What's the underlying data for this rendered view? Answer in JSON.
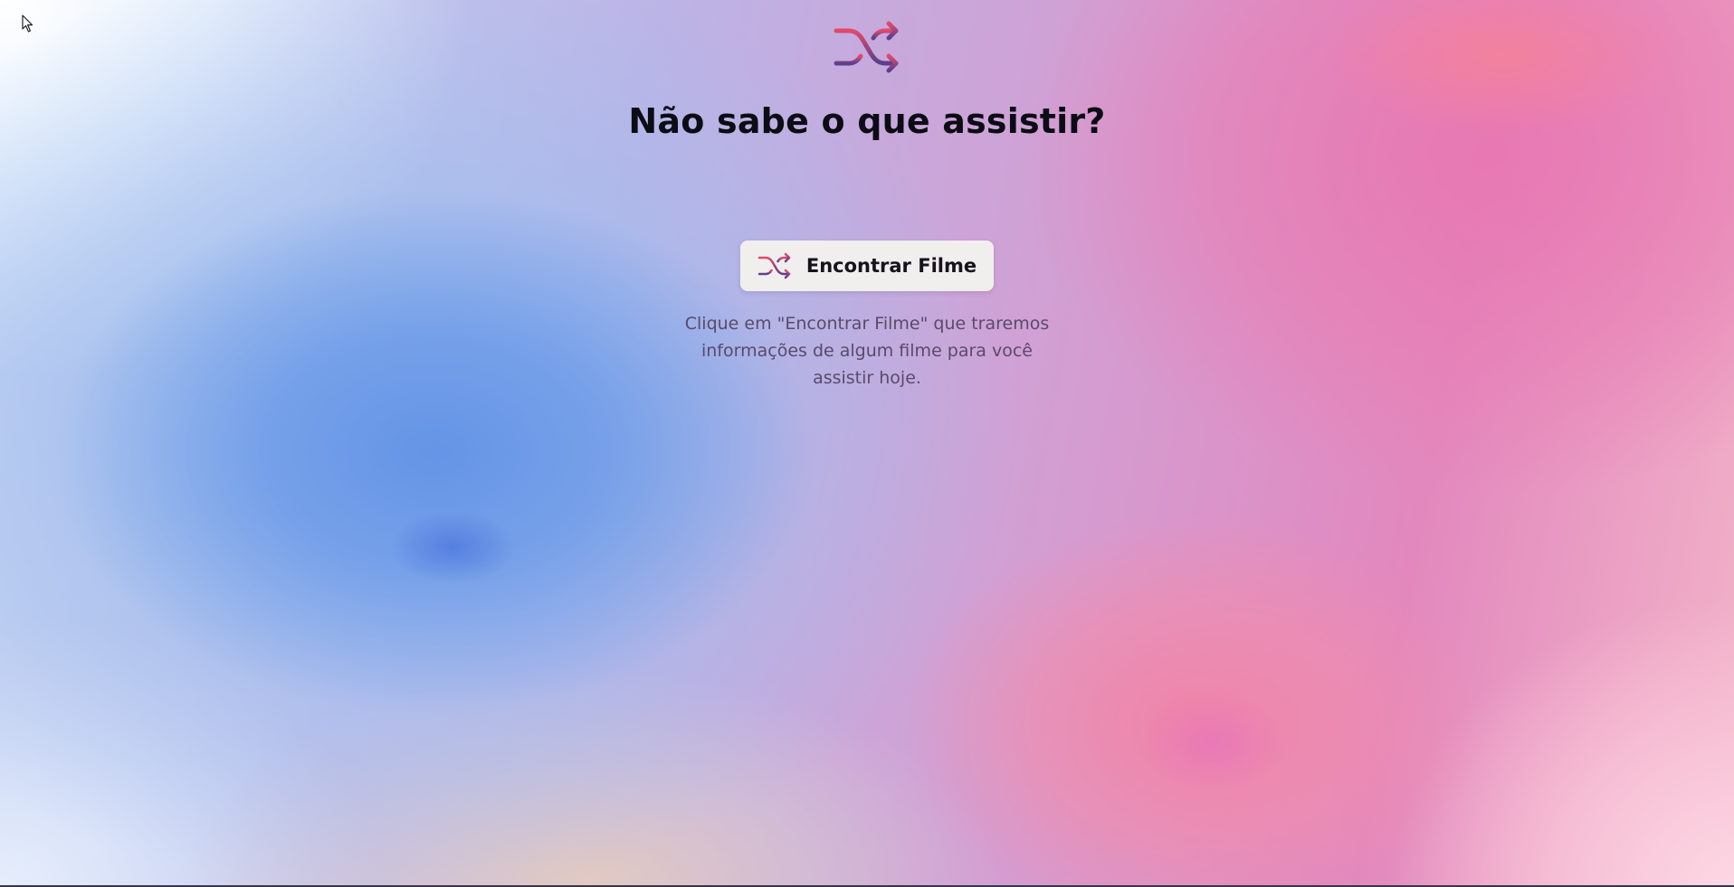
{
  "hero": {
    "title": "Não sabe o que assistir?",
    "logo_icon": "shuffle-icon"
  },
  "action": {
    "button_label": "Encontrar Filme",
    "button_icon": "shuffle-icon"
  },
  "description": "Clique em \"Encontrar Filme\" que traremos informações de algum filme para você assistir hoje.",
  "colors": {
    "icon_gradient_start": "#e24a6c",
    "icon_gradient_end": "#5b3f8e",
    "title_color": "#0c0c14",
    "button_background": "#f1eeee",
    "description_color": "#5a4a6a"
  }
}
